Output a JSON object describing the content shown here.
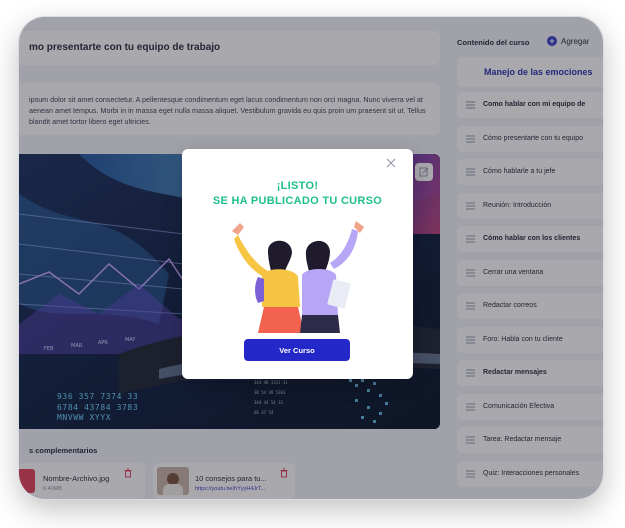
{
  "lesson": {
    "title": "mo presentarte con tu equipo de trabajo",
    "description": "ipsum dolor sit amet consectetur. A pellentesque condimentum eget lacus condimentum non orci magna. Nunc viverra vel at aenean amet tempus. Morbi in in massa eget nulla massa aliquet. Vestibulum gravida eu quis proin um praesent sit ut. Tellus blandit amet tortor libero eget ultricies."
  },
  "video": {
    "overlay_numbers": [
      "936 357 7374 33",
      "6784 43784 3783",
      "MNVWW XYYX"
    ],
    "months": [
      "FEB",
      "MAR",
      "APR",
      "MAY"
    ]
  },
  "complementary": {
    "title": "s complementarios",
    "files": [
      {
        "name": "Nombre-Archivo.jpg",
        "size": "0.40MB"
      },
      {
        "name": "10 consejos para tu...",
        "link": "https://youtu.be/hYyyH4JrT..."
      }
    ]
  },
  "sidebar": {
    "heading": "Contenido del curso",
    "add_label": "Agregar",
    "module": "Manejo de las emociones",
    "items": [
      {
        "label": "Como hablar con mi equipo de",
        "bold": true
      },
      {
        "label": "Cómo presentarte con tu equipo",
        "bold": false
      },
      {
        "label": "Cómo hablarle a tu jefe",
        "bold": false
      },
      {
        "label": "Reunión: Introducción",
        "bold": false
      },
      {
        "label": "Cómo hablar con los clientes",
        "bold": true
      },
      {
        "label": "Cerrar una ventana",
        "bold": false
      },
      {
        "label": "Redactar correos",
        "bold": false
      },
      {
        "label": "Foro: Habla con tu cliente",
        "bold": false
      },
      {
        "label": "Redactar mensajes",
        "bold": true
      },
      {
        "label": "Comunicación Efectiva",
        "bold": false
      },
      {
        "label": "Tarea: Redactar mensaje",
        "bold": false
      },
      {
        "label": "Quiz: Interacciones personales",
        "bold": false
      }
    ]
  },
  "modal": {
    "line1": "¡LISTO!",
    "line2": "SE HA PUBLICADO TU CURSO",
    "button": "Ver Curso"
  },
  "colors": {
    "accent": "#2528c9",
    "success": "#1fbf8f",
    "danger": "#e4405a",
    "module_text": "#2a2fb0"
  }
}
